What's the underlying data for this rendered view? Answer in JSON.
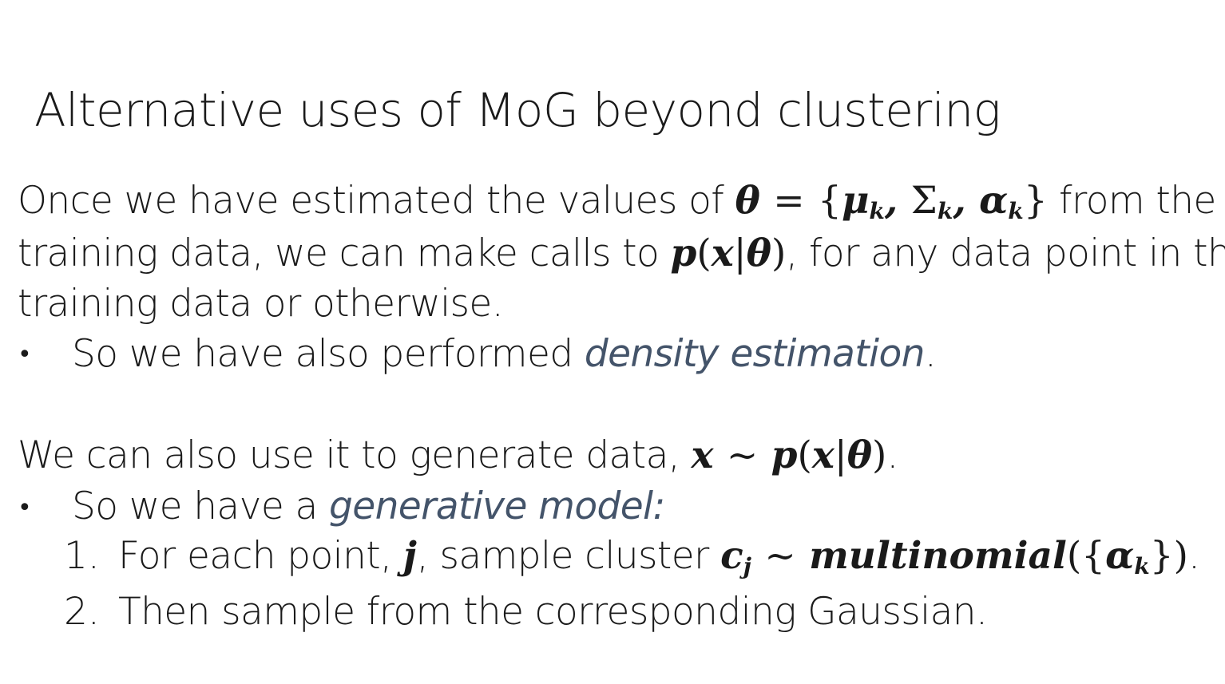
{
  "title": "Alternative uses of MoG beyond clustering",
  "para1": {
    "l1_pre": "Once we have estimated the values of ",
    "l1_math": "θ = {μk, Σk, αk}",
    "l1_post": " from the",
    "l2_pre": "training data, we can make calls to ",
    "l2_math": "p(x|θ)",
    "l2_post": ", for any data point in the",
    "l3": "training data or otherwise."
  },
  "bullet1": {
    "symbol": "•",
    "pre": "So we have also performed ",
    "emph": "density estimation",
    "post": "."
  },
  "para2": {
    "pre": "We can also use it to generate data, ",
    "math": "x ~ p(x|θ)",
    "post": "."
  },
  "bullet2": {
    "symbol": "•",
    "pre": "So we have a ",
    "emph": "generative model:",
    "post": ""
  },
  "steps": [
    {
      "num": "1.",
      "pre": "For each point, ",
      "m1": "j",
      "mid": ", sample cluster ",
      "m2": "cj ~ multinomial({αk})",
      "post": "."
    },
    {
      "num": "2.",
      "text": "Then sample from the corresponding Gaussian."
    }
  ]
}
